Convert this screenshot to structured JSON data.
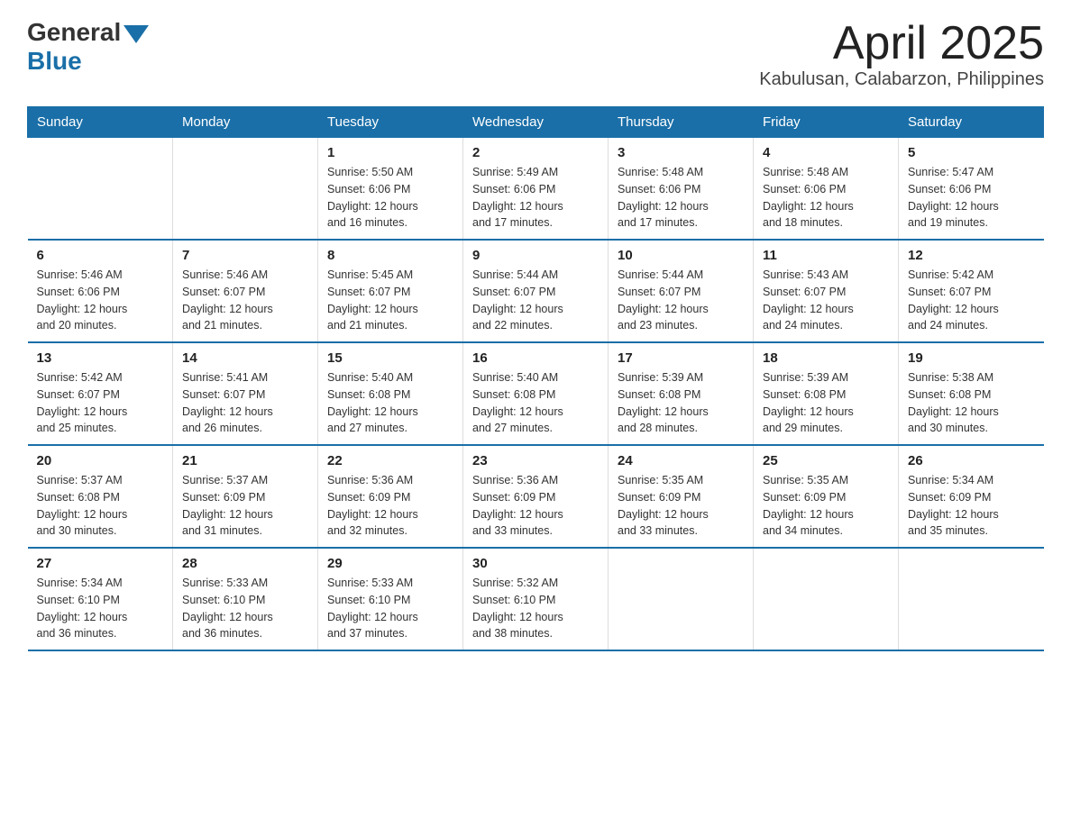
{
  "header": {
    "logo_general": "General",
    "logo_blue": "Blue",
    "title": "April 2025",
    "subtitle": "Kabulusan, Calabarzon, Philippines"
  },
  "weekdays": [
    "Sunday",
    "Monday",
    "Tuesday",
    "Wednesday",
    "Thursday",
    "Friday",
    "Saturday"
  ],
  "weeks": [
    [
      {
        "day": "",
        "info": ""
      },
      {
        "day": "",
        "info": ""
      },
      {
        "day": "1",
        "info": "Sunrise: 5:50 AM\nSunset: 6:06 PM\nDaylight: 12 hours\nand 16 minutes."
      },
      {
        "day": "2",
        "info": "Sunrise: 5:49 AM\nSunset: 6:06 PM\nDaylight: 12 hours\nand 17 minutes."
      },
      {
        "day": "3",
        "info": "Sunrise: 5:48 AM\nSunset: 6:06 PM\nDaylight: 12 hours\nand 17 minutes."
      },
      {
        "day": "4",
        "info": "Sunrise: 5:48 AM\nSunset: 6:06 PM\nDaylight: 12 hours\nand 18 minutes."
      },
      {
        "day": "5",
        "info": "Sunrise: 5:47 AM\nSunset: 6:06 PM\nDaylight: 12 hours\nand 19 minutes."
      }
    ],
    [
      {
        "day": "6",
        "info": "Sunrise: 5:46 AM\nSunset: 6:06 PM\nDaylight: 12 hours\nand 20 minutes."
      },
      {
        "day": "7",
        "info": "Sunrise: 5:46 AM\nSunset: 6:07 PM\nDaylight: 12 hours\nand 21 minutes."
      },
      {
        "day": "8",
        "info": "Sunrise: 5:45 AM\nSunset: 6:07 PM\nDaylight: 12 hours\nand 21 minutes."
      },
      {
        "day": "9",
        "info": "Sunrise: 5:44 AM\nSunset: 6:07 PM\nDaylight: 12 hours\nand 22 minutes."
      },
      {
        "day": "10",
        "info": "Sunrise: 5:44 AM\nSunset: 6:07 PM\nDaylight: 12 hours\nand 23 minutes."
      },
      {
        "day": "11",
        "info": "Sunrise: 5:43 AM\nSunset: 6:07 PM\nDaylight: 12 hours\nand 24 minutes."
      },
      {
        "day": "12",
        "info": "Sunrise: 5:42 AM\nSunset: 6:07 PM\nDaylight: 12 hours\nand 24 minutes."
      }
    ],
    [
      {
        "day": "13",
        "info": "Sunrise: 5:42 AM\nSunset: 6:07 PM\nDaylight: 12 hours\nand 25 minutes."
      },
      {
        "day": "14",
        "info": "Sunrise: 5:41 AM\nSunset: 6:07 PM\nDaylight: 12 hours\nand 26 minutes."
      },
      {
        "day": "15",
        "info": "Sunrise: 5:40 AM\nSunset: 6:08 PM\nDaylight: 12 hours\nand 27 minutes."
      },
      {
        "day": "16",
        "info": "Sunrise: 5:40 AM\nSunset: 6:08 PM\nDaylight: 12 hours\nand 27 minutes."
      },
      {
        "day": "17",
        "info": "Sunrise: 5:39 AM\nSunset: 6:08 PM\nDaylight: 12 hours\nand 28 minutes."
      },
      {
        "day": "18",
        "info": "Sunrise: 5:39 AM\nSunset: 6:08 PM\nDaylight: 12 hours\nand 29 minutes."
      },
      {
        "day": "19",
        "info": "Sunrise: 5:38 AM\nSunset: 6:08 PM\nDaylight: 12 hours\nand 30 minutes."
      }
    ],
    [
      {
        "day": "20",
        "info": "Sunrise: 5:37 AM\nSunset: 6:08 PM\nDaylight: 12 hours\nand 30 minutes."
      },
      {
        "day": "21",
        "info": "Sunrise: 5:37 AM\nSunset: 6:09 PM\nDaylight: 12 hours\nand 31 minutes."
      },
      {
        "day": "22",
        "info": "Sunrise: 5:36 AM\nSunset: 6:09 PM\nDaylight: 12 hours\nand 32 minutes."
      },
      {
        "day": "23",
        "info": "Sunrise: 5:36 AM\nSunset: 6:09 PM\nDaylight: 12 hours\nand 33 minutes."
      },
      {
        "day": "24",
        "info": "Sunrise: 5:35 AM\nSunset: 6:09 PM\nDaylight: 12 hours\nand 33 minutes."
      },
      {
        "day": "25",
        "info": "Sunrise: 5:35 AM\nSunset: 6:09 PM\nDaylight: 12 hours\nand 34 minutes."
      },
      {
        "day": "26",
        "info": "Sunrise: 5:34 AM\nSunset: 6:09 PM\nDaylight: 12 hours\nand 35 minutes."
      }
    ],
    [
      {
        "day": "27",
        "info": "Sunrise: 5:34 AM\nSunset: 6:10 PM\nDaylight: 12 hours\nand 36 minutes."
      },
      {
        "day": "28",
        "info": "Sunrise: 5:33 AM\nSunset: 6:10 PM\nDaylight: 12 hours\nand 36 minutes."
      },
      {
        "day": "29",
        "info": "Sunrise: 5:33 AM\nSunset: 6:10 PM\nDaylight: 12 hours\nand 37 minutes."
      },
      {
        "day": "30",
        "info": "Sunrise: 5:32 AM\nSunset: 6:10 PM\nDaylight: 12 hours\nand 38 minutes."
      },
      {
        "day": "",
        "info": ""
      },
      {
        "day": "",
        "info": ""
      },
      {
        "day": "",
        "info": ""
      }
    ]
  ]
}
